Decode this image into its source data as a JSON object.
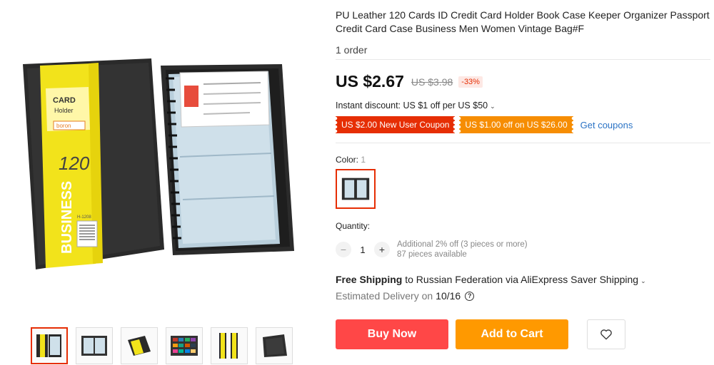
{
  "product": {
    "title": "PU Leather 120 Cards ID Credit Card Holder Book Case Keeper Organizer Passport Credit Card Case Business Men Women Vintage Bag#F",
    "orders": "1 order"
  },
  "gallery": {
    "main_image": {
      "brand_card": "CARD",
      "brand_holder": "Holder",
      "brand_name": "boron",
      "capacity": "120",
      "band_text": "BUSINESS",
      "model": "H-1208"
    },
    "thumbnails": [
      "thumb-1",
      "thumb-2",
      "thumb-3",
      "thumb-4",
      "thumb-5",
      "thumb-6"
    ],
    "selected_index": 0
  },
  "price": {
    "current": "US $2.67",
    "original": "US $3.98",
    "discount": "-33%"
  },
  "instant_discount": {
    "text": "Instant discount: US $1 off per US $50"
  },
  "coupons": {
    "items": [
      "US $2.00 New User Coupon",
      "US $1.00 off on US $26.00"
    ],
    "get_label": "Get coupons"
  },
  "color": {
    "label": "Color:",
    "count": "1"
  },
  "quantity": {
    "label": "Quantity:",
    "value": "1",
    "minus": "−",
    "plus": "+",
    "additional": "Additional 2% off (3 pieces or more)",
    "available": "87 pieces available"
  },
  "shipping": {
    "free": "Free Shipping",
    "rest": "to Russian Federation via AliExpress Saver Shipping",
    "delivery_label": "Estimated Delivery on",
    "delivery_date": "10/16"
  },
  "actions": {
    "buy_now": "Buy Now",
    "add_to_cart": "Add to Cart"
  },
  "colors": {
    "accent_red": "#e62e04",
    "buy_button": "#ff4747",
    "cart_button": "#ff9900",
    "link_blue": "#2b73c5",
    "coupon_orange": "#f68d03"
  },
  "icons": {
    "dropdown": "chevron-down-icon",
    "help": "question-circle-icon",
    "wishlist": "heart-outline-icon"
  }
}
